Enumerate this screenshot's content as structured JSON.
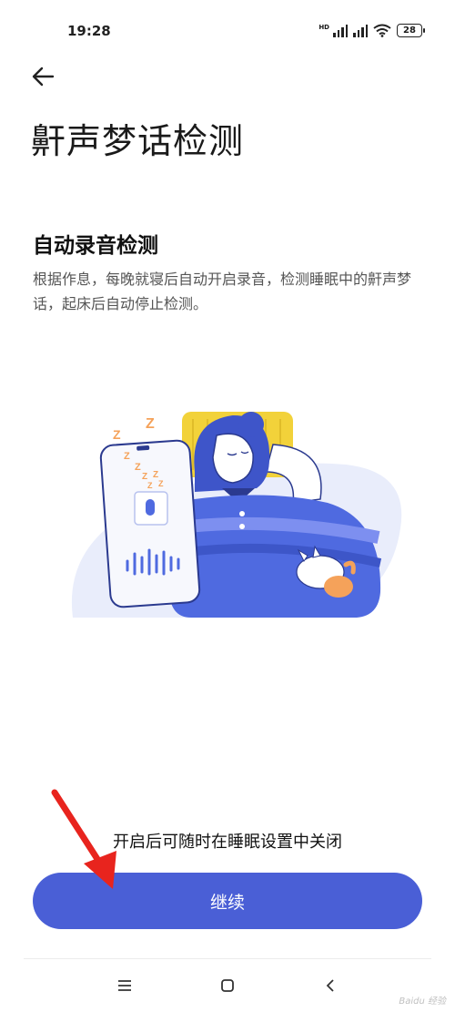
{
  "status_bar": {
    "time": "19:28",
    "battery": "28",
    "network_label": "HD"
  },
  "page": {
    "title": "鼾声梦话检测",
    "section_title": "自动录音检测",
    "section_description": "根据作息，每晚就寝后自动开启录音，检测睡眠中的鼾声梦话，起床后自动停止检测。"
  },
  "illustration": {
    "snore_letters": [
      "Z",
      "Z",
      "Z",
      "Z",
      "Z",
      "Z",
      "Z",
      "Z"
    ]
  },
  "footer": {
    "footnote": "开启后可随时在睡眠设置中关闭",
    "continue_label": "继续"
  },
  "watermark": "Baidu 经验",
  "colors": {
    "accent": "#4a5fd6",
    "arrow": "#e8241e",
    "pillow": "#f2d23a",
    "blanket": "#4f6ae0",
    "hair": "#3e55c9",
    "blob": "#e9edfb",
    "cat_orange": "#f5a25a"
  }
}
